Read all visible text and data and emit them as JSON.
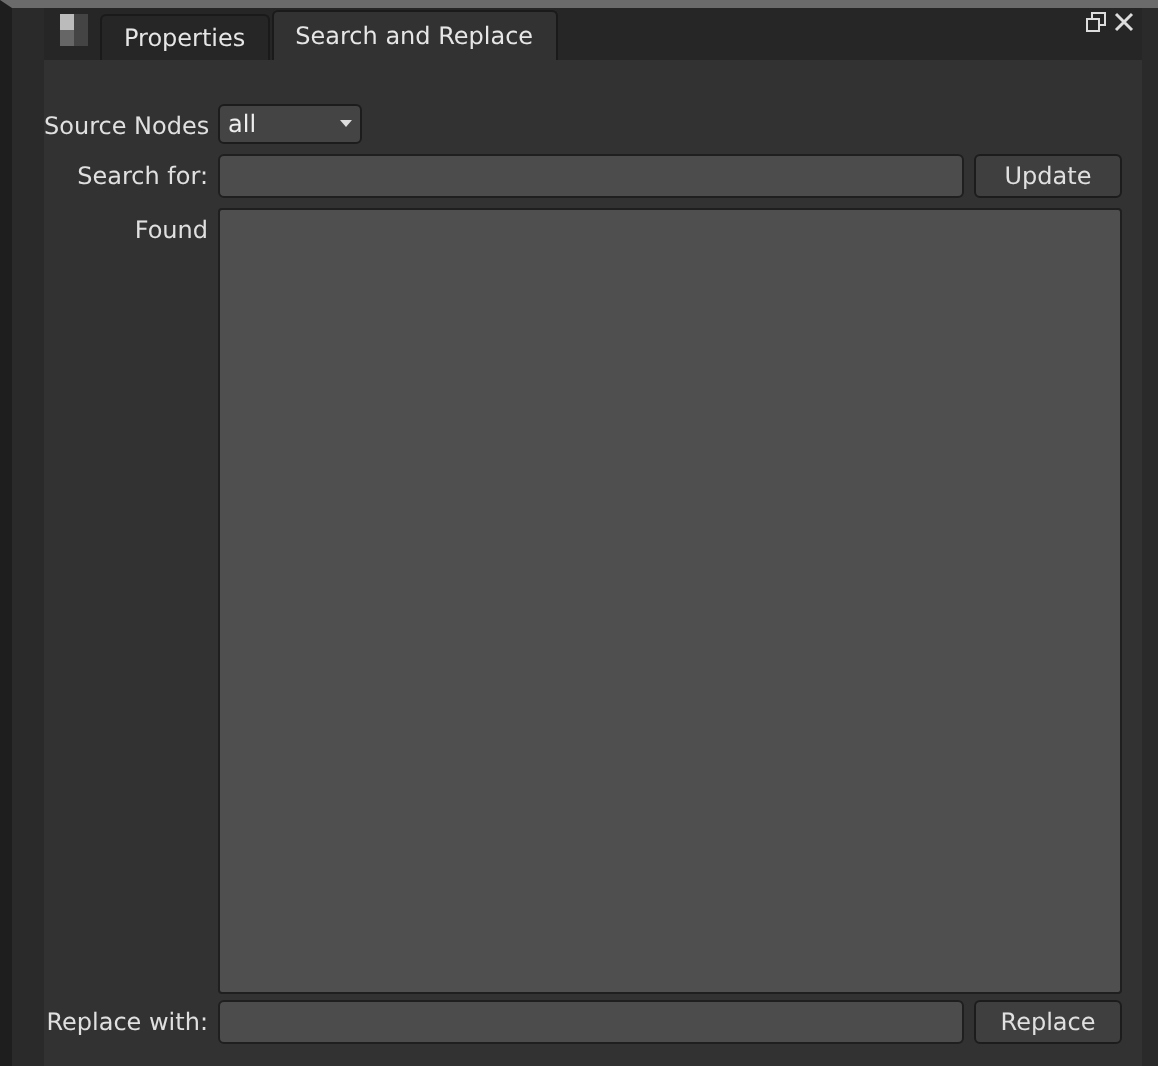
{
  "tabs": [
    {
      "label": "Properties",
      "selected": false
    },
    {
      "label": "Search and Replace",
      "selected": true
    }
  ],
  "source_nodes": {
    "label": "Source Nodes",
    "value": "all"
  },
  "search": {
    "label": "Search for:",
    "button": "Update"
  },
  "found": {
    "label": "Found"
  },
  "replace": {
    "label": "Replace with:",
    "button": "Replace"
  }
}
